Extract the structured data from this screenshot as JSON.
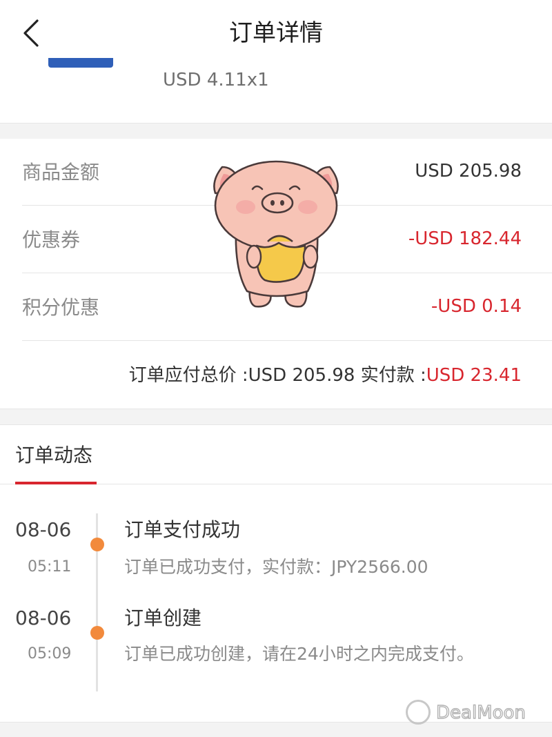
{
  "header": {
    "title": "订单详情",
    "back_icon": "chevron-left-icon"
  },
  "product": {
    "price_qty": "USD 4.11x1"
  },
  "price_summary": {
    "rows": [
      {
        "label": "商品金额",
        "value": "USD 205.98",
        "color": "#333333"
      },
      {
        "label": "优惠券",
        "value": "-USD 182.44",
        "color": "#d8262e"
      },
      {
        "label": "积分优惠",
        "value": "-USD 0.14",
        "color": "#d8262e"
      }
    ],
    "total_label": "订单应付总价 :",
    "total_value": "USD 205.98",
    "paid_label": "实付款 :",
    "paid_value": "USD 23.41"
  },
  "order_status": {
    "tab_label": "订单动态",
    "events": [
      {
        "date": "08-06",
        "time": "05:11",
        "title": "订单支付成功",
        "desc": "订单已成功支付，实付款：JPY2566.00"
      },
      {
        "date": "08-06",
        "time": "05:09",
        "title": "订单创建",
        "desc": "订单已成功创建，请在24小时之内完成支付。"
      }
    ]
  },
  "sticker": {
    "icon": "pig-holding-gold-sticker"
  },
  "watermark": {
    "text": "DealMoon",
    "icon": "dealmoon-logo-icon"
  },
  "colors": {
    "accent_red": "#d8262e",
    "timeline_dot": "#f28a3c",
    "page_gap": "#f3f3f3"
  }
}
